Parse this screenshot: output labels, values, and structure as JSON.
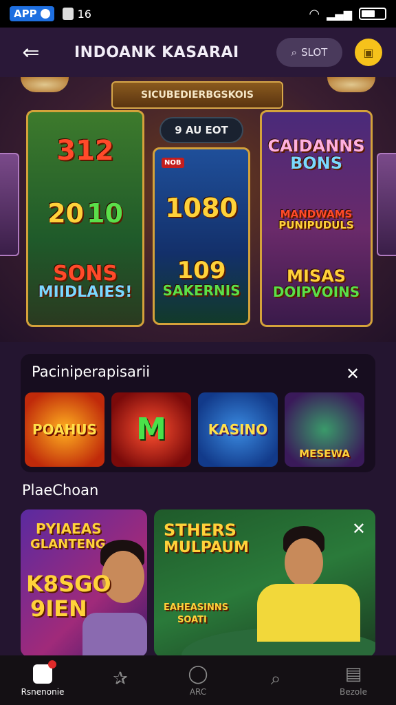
{
  "status_bar": {
    "app_label": "APP",
    "number": "16"
  },
  "header": {
    "title": "INDOANK KASARAI",
    "search_label": "SLOT"
  },
  "hero": {
    "plaque_text": "SICUBEDIERBGSKOIS",
    "pill_text": "9 AU EOT",
    "mini_tag": "NOB",
    "left_card": {
      "line1": "312",
      "line2": "20",
      "line3": "10",
      "line4": "SONS",
      "line5": "MIIDLAIES!"
    },
    "mid_card": {
      "line1": "1080",
      "line2": "109",
      "line3": "SAKERNIS"
    },
    "right_card": {
      "line1": "CAIDANNS",
      "line2": "BONS",
      "line3": "MANDWAMS",
      "line4": "PUNIPUDULS",
      "line5": "MISAS",
      "line6": "DOIPVOINS"
    }
  },
  "popular_panel": {
    "title": "Paciniperapisarii",
    "tiles": [
      {
        "text": "POAHUS",
        "name": "game-tile-1"
      },
      {
        "text": "M",
        "name": "game-tile-2"
      },
      {
        "text": "KASINO",
        "name": "game-tile-3"
      },
      {
        "text": "MESEWA",
        "name": "game-tile-4"
      }
    ]
  },
  "section_title": "PlaeChoan",
  "promo_left": {
    "line1": "PYIAEAS",
    "line2": "GLANTENG",
    "line3": "K8SGO",
    "line4": "9IEN"
  },
  "promo_right": {
    "line1": "STHERS",
    "line2": "MULPAUM",
    "line3": "EAHEASINNS",
    "line4": "SOATI"
  },
  "bottom_nav": [
    {
      "label": "Rsnenonie",
      "icon": "home-icon",
      "active": true
    },
    {
      "label": "",
      "icon": "star-icon",
      "active": false
    },
    {
      "label": "ARC",
      "icon": "circle-icon",
      "active": false
    },
    {
      "label": "",
      "icon": "search-icon",
      "active": false
    },
    {
      "label": "Bezole",
      "icon": "grid-icon",
      "active": false
    }
  ],
  "colors": {
    "background": "#241530",
    "accent_gold": "#f6c21b",
    "header": "#2a1838",
    "panel": "#170d1f"
  }
}
